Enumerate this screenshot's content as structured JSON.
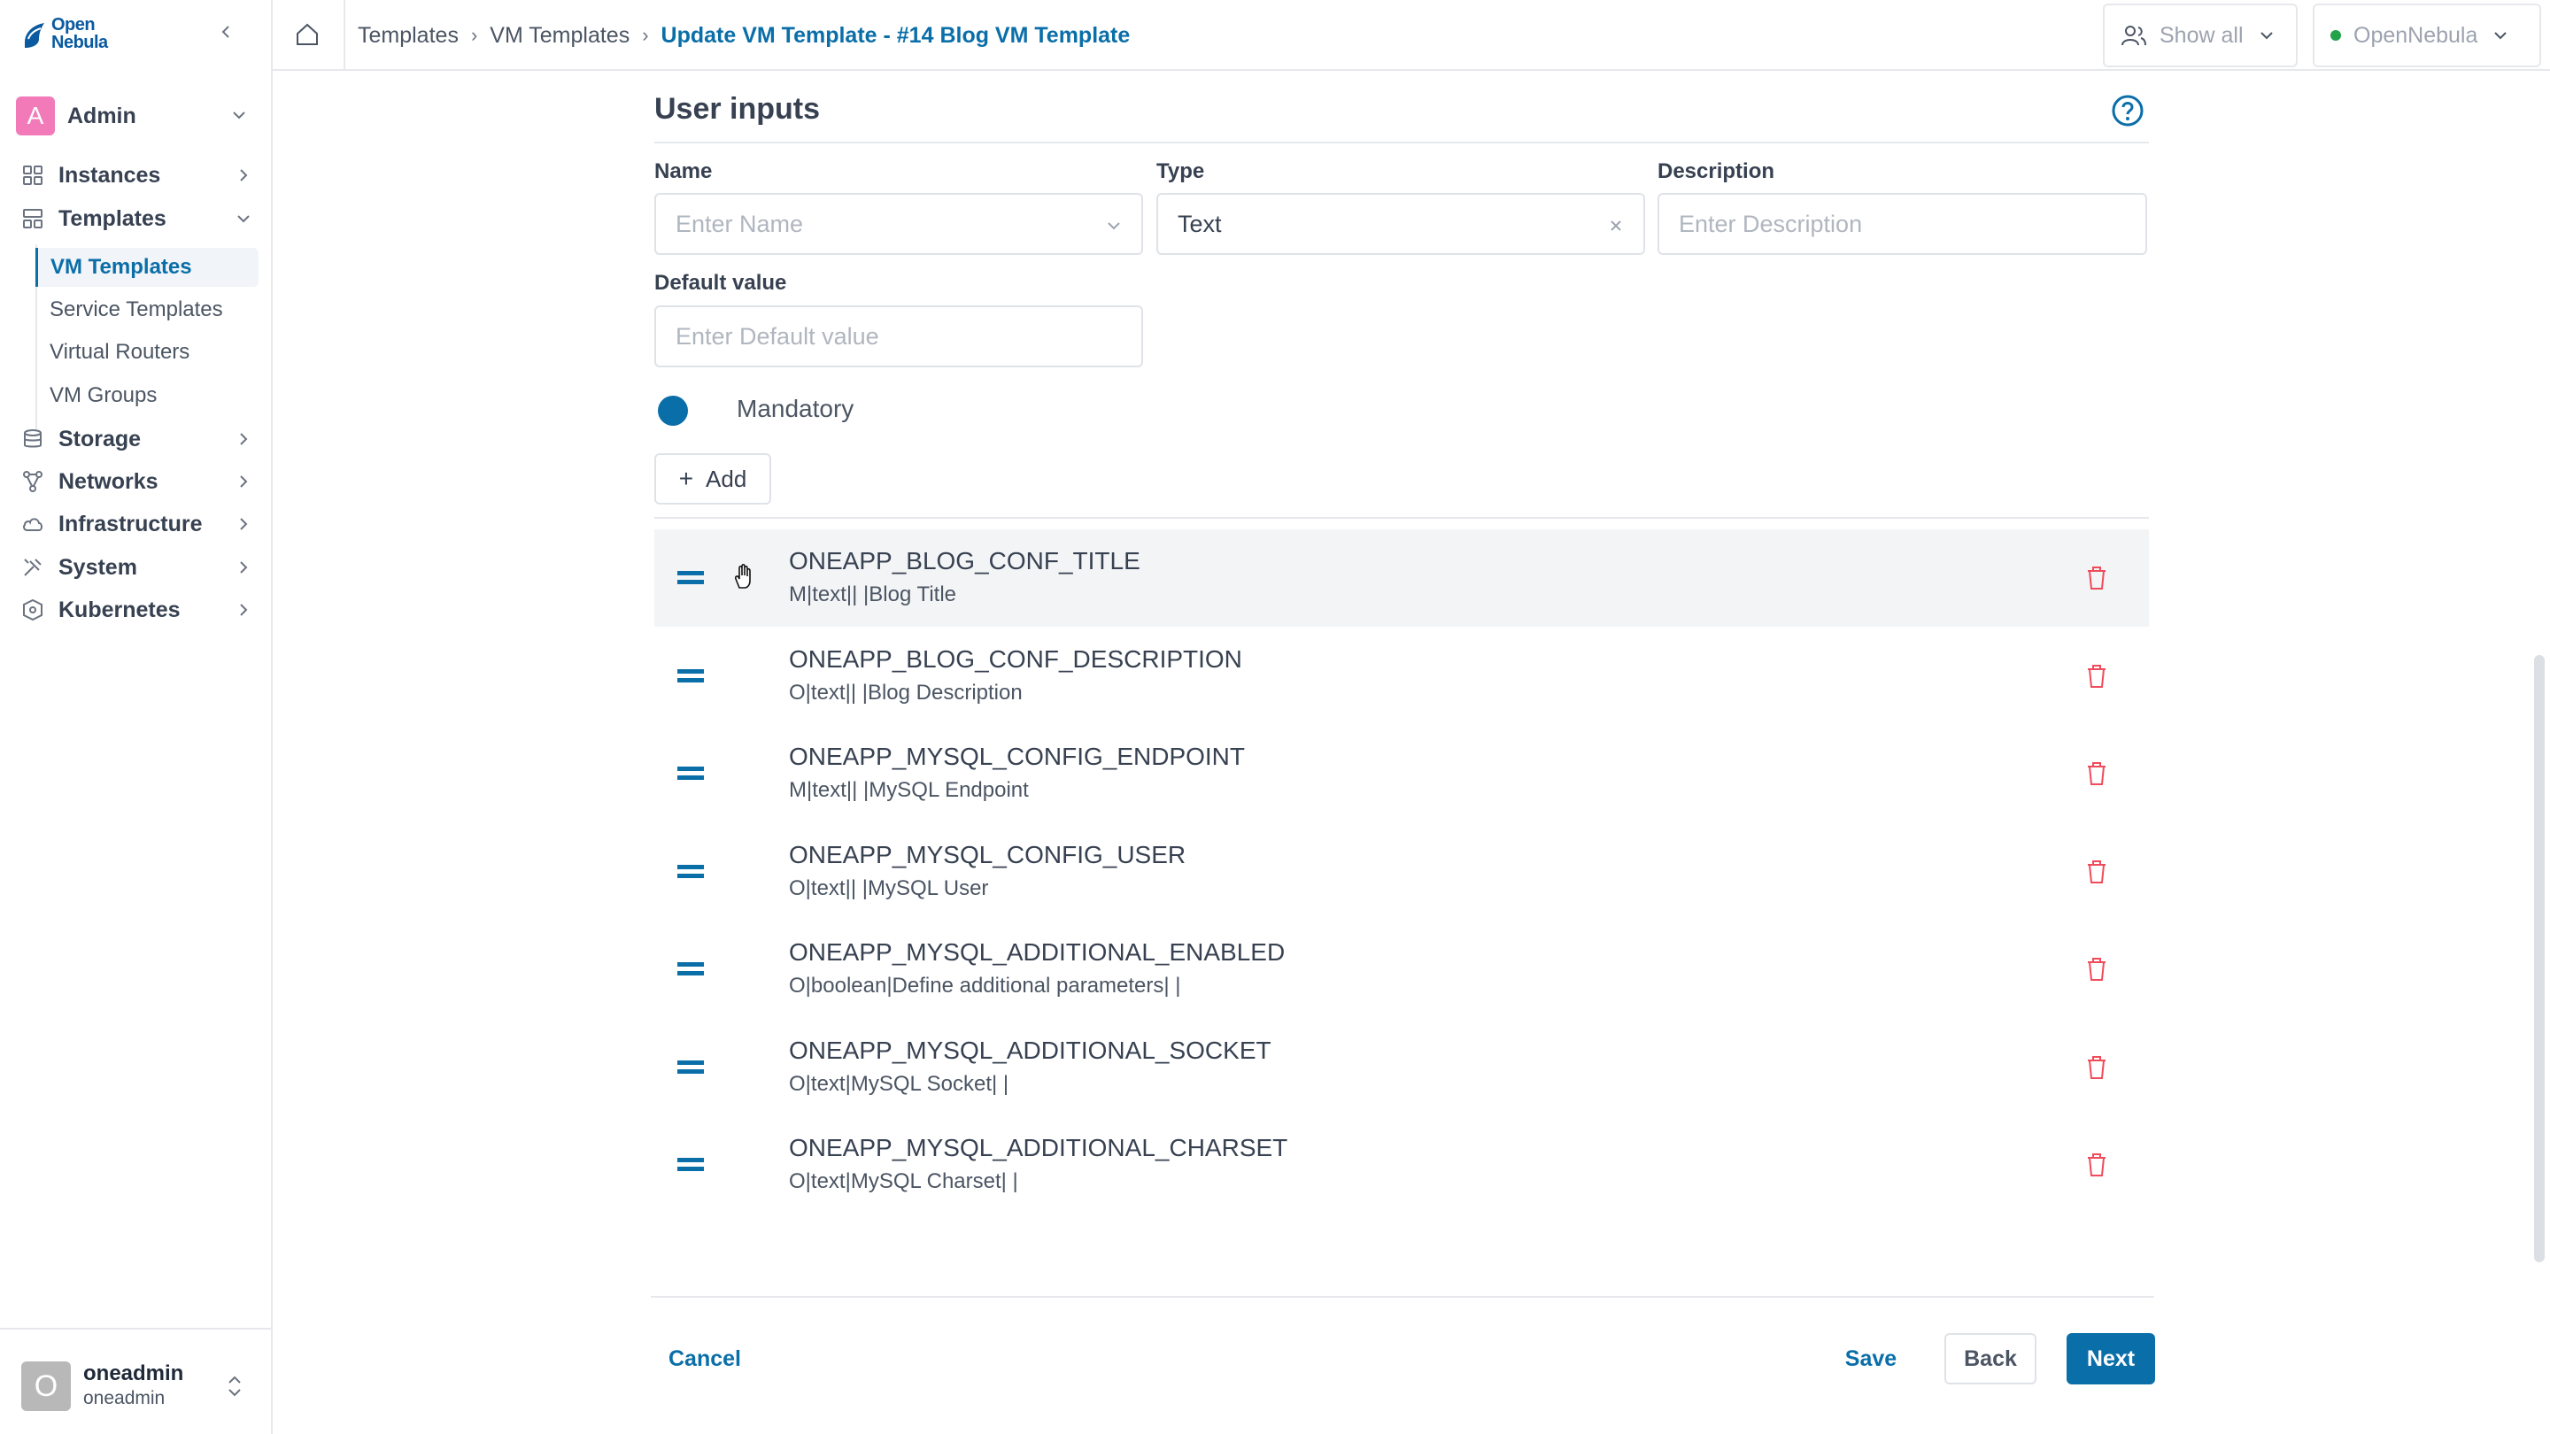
{
  "app": {
    "logo_line1": "Open",
    "logo_line2": "Nebula"
  },
  "sidebar": {
    "group": {
      "initial": "A",
      "name": "Admin"
    },
    "nav": [
      {
        "label": "Instances"
      },
      {
        "label": "Templates"
      },
      {
        "label": "Storage"
      },
      {
        "label": "Networks"
      },
      {
        "label": "Infrastructure"
      },
      {
        "label": "System"
      },
      {
        "label": "Kubernetes"
      }
    ],
    "sub_items": [
      {
        "label": "VM Templates",
        "active": true
      },
      {
        "label": "Service Templates"
      },
      {
        "label": "Virtual Routers"
      },
      {
        "label": "VM Groups"
      }
    ],
    "user": {
      "initial": "O",
      "name": "oneadmin",
      "sub": "oneadmin"
    }
  },
  "topbar": {
    "breadcrumb": [
      "Templates",
      "VM Templates",
      "Update VM Template - #14 Blog VM Template"
    ],
    "view_select": "Show all",
    "zone_select": "OpenNebula"
  },
  "form": {
    "title": "User inputs",
    "name_label": "Name",
    "name_placeholder": "Enter Name",
    "type_label": "Type",
    "type_value": "Text",
    "description_label": "Description",
    "description_placeholder": "Enter Description",
    "default_label": "Default value",
    "default_placeholder": "Enter Default value",
    "mandatory_label": "Mandatory",
    "add_label": "Add"
  },
  "inputs": [
    {
      "name": "ONEAPP_BLOG_CONF_TITLE",
      "spec": "M|text|| |Blog Title"
    },
    {
      "name": "ONEAPP_BLOG_CONF_DESCRIPTION",
      "spec": "O|text|| |Blog Description"
    },
    {
      "name": "ONEAPP_MYSQL_CONFIG_ENDPOINT",
      "spec": "M|text|| |MySQL Endpoint"
    },
    {
      "name": "ONEAPP_MYSQL_CONFIG_USER",
      "spec": "O|text|| |MySQL User"
    },
    {
      "name": "ONEAPP_MYSQL_ADDITIONAL_ENABLED",
      "spec": "O|boolean|Define additional parameters| |"
    },
    {
      "name": "ONEAPP_MYSQL_ADDITIONAL_SOCKET",
      "spec": "O|text|MySQL Socket| |"
    },
    {
      "name": "ONEAPP_MYSQL_ADDITIONAL_CHARSET",
      "spec": "O|text|MySQL Charset| |"
    }
  ],
  "footer": {
    "cancel": "Cancel",
    "save": "Save",
    "back": "Back",
    "next": "Next"
  },
  "colors": {
    "accent": "#0a6ea8",
    "danger": "#ef4b5b",
    "status_ok": "#22a34a"
  }
}
